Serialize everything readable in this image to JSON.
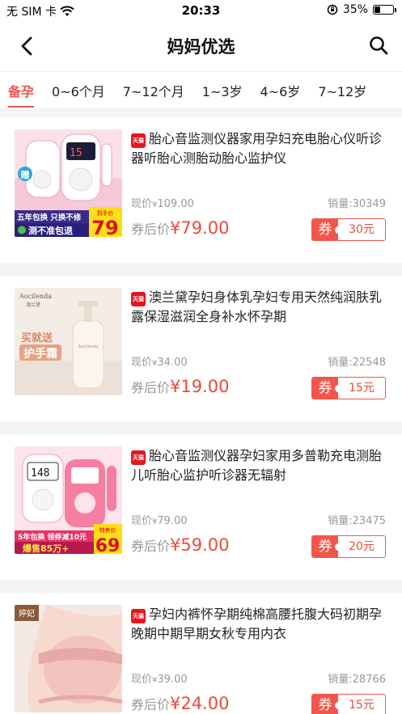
{
  "status_bar": {
    "carrier": "无 SIM 卡",
    "time": "20:33",
    "battery": "35%",
    "battery_level": 0.35
  },
  "nav": {
    "title": "妈妈优选"
  },
  "tabs": [
    {
      "label": "备孕",
      "active": true
    },
    {
      "label": "0~6个月",
      "active": false
    },
    {
      "label": "7~12个月",
      "active": false
    },
    {
      "label": "1~3岁",
      "active": false
    },
    {
      "label": "4~6岁",
      "active": false
    },
    {
      "label": "7~12岁",
      "active": false
    }
  ],
  "colors": {
    "accent": "#f2564a",
    "price": "#e84a3d",
    "tmall": "#e6161b"
  },
  "products": [
    {
      "badge": "天猫",
      "title": "胎心音监测仪器家用孕妇充电胎心仪听诊器听胎心测胎动胎心监护仪",
      "price_label": "现价",
      "currency": "¥",
      "price": "109.00",
      "sales_label": "销量:",
      "sales": "30349",
      "after_label": "券后价",
      "after_price": "79.00",
      "coupon_tag": "券",
      "coupon_value": "30元",
      "thumb_text": {
        "gift": "赠",
        "line1": "五年包换 只换不修",
        "line2": "测不准包退",
        "promo": "到手价",
        "promo_price": "79"
      }
    },
    {
      "badge": "天猫",
      "title": "澳兰黛孕妇身体乳孕妇专用天然纯润肤乳露保湿滋润全身补水怀孕期",
      "price_label": "现价",
      "currency": "¥",
      "price": "34.00",
      "sales_label": "销量:",
      "sales": "22548",
      "after_label": "券后价",
      "after_price": "19.00",
      "coupon_tag": "券",
      "coupon_value": "15元",
      "thumb_text": {
        "brand": "Aocilenda",
        "brand_cn": "澳兰黛",
        "promo1": "买就送",
        "promo2": "护手霜"
      }
    },
    {
      "badge": "天猫",
      "title": "胎心音监测仪器孕妇家用多普勒充电测胎儿听胎心监护听诊器无辐射",
      "price_label": "现价",
      "currency": "¥",
      "price": "79.00",
      "sales_label": "销量:",
      "sales": "23475",
      "after_label": "券后价",
      "after_price": "59.00",
      "coupon_tag": "券",
      "coupon_value": "20元",
      "thumb_text": {
        "line1": "5年包换 领券减10元",
        "line2": "爆售85万+",
        "promo": "特卖价",
        "promo_price": "69"
      }
    },
    {
      "badge": "天猫",
      "title": "孕妇内裤怀孕期纯棉高腰托腹大码初期孕晚期中期早期女秋专用内衣",
      "price_label": "现价",
      "currency": "¥",
      "price": "39.00",
      "sales_label": "销量:",
      "sales": "28766",
      "after_label": "券后价",
      "after_price": "24.00",
      "coupon_tag": "券",
      "coupon_value": "15元",
      "thumb_text": {
        "brand": "婷妃"
      }
    }
  ]
}
